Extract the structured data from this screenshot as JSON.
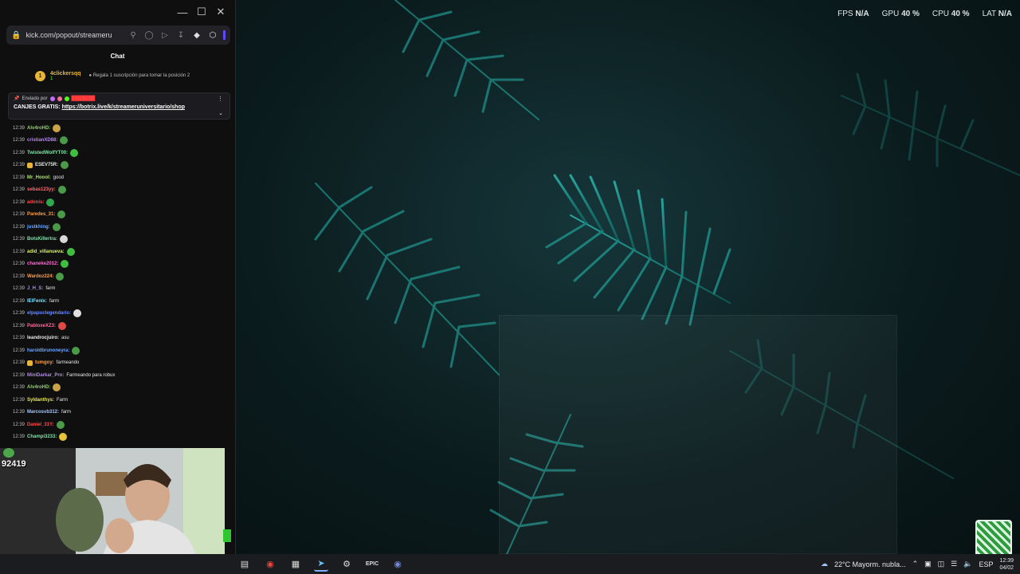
{
  "overlay": {
    "fps_label": "FPS",
    "fps_value": "N/A",
    "gpu_label": "GPU",
    "gpu_value": "40 %",
    "cpu_label": "CPU",
    "cpu_value": "40 %",
    "lat_label": "LAT",
    "lat_value": "N/A"
  },
  "browser": {
    "url": "kick.com/popout/streameru",
    "icons": [
      "search-icon",
      "shield-icon",
      "play-icon",
      "download-icon",
      "extension-icon",
      "cube-icon"
    ]
  },
  "chat": {
    "title": "Chat",
    "gifter": {
      "rank": "1",
      "name": "4clickersqq",
      "sub": "1",
      "text": "Regala 1 suscripción para tomar la posición 2"
    },
    "pinned": {
      "sent_by": "Enviado por",
      "message_prefix": "CANJES GRATIS:",
      "link": "https://botrix.live/k/streameruniversitario/shop"
    },
    "messages": [
      {
        "time": "12:39",
        "user": "Alv4roHD:",
        "text": "",
        "color": "#8fd16a",
        "badge": false,
        "emote": "#c9a24a"
      },
      {
        "time": "12:39",
        "user": "cristianXD88:",
        "text": "",
        "color": "#b08be0",
        "badge": false,
        "emote": "#4a9a4a"
      },
      {
        "time": "12:39",
        "user": "TwistedWolfYT00:",
        "text": "",
        "color": "#7fe3a8",
        "badge": false,
        "emote": "#3fbf3f"
      },
      {
        "time": "12:39",
        "user": "ESEV75R:",
        "text": "",
        "color": "#e8e8e8",
        "badge": true,
        "emote": "#4a9a4a"
      },
      {
        "time": "12:39",
        "user": "Mr_Hoool:",
        "text": "good",
        "color": "#a6e36a",
        "badge": false,
        "emote": ""
      },
      {
        "time": "12:39",
        "user": "sebas123yy:",
        "text": "",
        "color": "#ff6b6b",
        "badge": false,
        "emote": "#4a9a4a"
      },
      {
        "time": "12:39",
        "user": "adonis:",
        "text": "",
        "color": "#ff4b4b",
        "badge": false,
        "emote": "#2fa84f"
      },
      {
        "time": "12:39",
        "user": "Paredes_31:",
        "text": "",
        "color": "#ff9f4a",
        "badge": false,
        "emote": "#4a9a4a"
      },
      {
        "time": "12:39",
        "user": "justkhing:",
        "text": "",
        "color": "#6aa8ff",
        "badge": false,
        "emote": "#4a9a4a"
      },
      {
        "time": "12:39",
        "user": "BotsKillertra:",
        "text": "",
        "color": "#7fe3a8",
        "badge": false,
        "emote": "#d8d8d8"
      },
      {
        "time": "12:39",
        "user": "adid_villanueva:",
        "text": "",
        "color": "#d6f06a",
        "badge": false,
        "emote": "#3fbf3f"
      },
      {
        "time": "12:39",
        "user": "chaneke2012:",
        "text": "",
        "color": "#ff6bd1",
        "badge": false,
        "emote": "#3fbf3f"
      },
      {
        "time": "12:39",
        "user": "Wardoz224:",
        "text": "",
        "color": "#ff9f4a",
        "badge": false,
        "emote": "#4a9a4a"
      },
      {
        "time": "12:39",
        "user": "J_H_S:",
        "text": "farm",
        "color": "#b08be0",
        "badge": false,
        "emote": ""
      },
      {
        "time": "12:39",
        "user": "lElFenix:",
        "text": "farm",
        "color": "#7fe3ff",
        "badge": false,
        "emote": ""
      },
      {
        "time": "12:39",
        "user": "elpapuclegendario:",
        "text": "",
        "color": "#6a8bff",
        "badge": false,
        "emote": "#e0e0e0"
      },
      {
        "time": "12:39",
        "user": "PabloxeXZ3:",
        "text": "",
        "color": "#ff6b9f",
        "badge": false,
        "emote": "#e04848"
      },
      {
        "time": "12:39",
        "user": "leandrocjuiro:",
        "text": "asu",
        "color": "#e8e8e8",
        "badge": false,
        "emote": ""
      },
      {
        "time": "12:39",
        "user": "haroldbrunoneyra:",
        "text": "",
        "color": "#6aa8ff",
        "badge": false,
        "emote": "#4a9a4a"
      },
      {
        "time": "12:39",
        "user": "tumgoy:",
        "text": "farmeando",
        "color": "#ff9f4a",
        "badge": true,
        "emote": ""
      },
      {
        "time": "12:39",
        "user": "MiniDarkar_Pro:",
        "text": "Farmeando para robux",
        "color": "#b08be0",
        "badge": false,
        "emote": ""
      },
      {
        "time": "12:39",
        "user": "Alv4roHD:",
        "text": "",
        "color": "#8fd16a",
        "badge": false,
        "emote": "#c9a24a"
      },
      {
        "time": "12:39",
        "user": "Syldanthys:",
        "text": "Farm",
        "color": "#e6e36a",
        "badge": false,
        "emote": ""
      },
      {
        "time": "12:39",
        "user": "Marcosvb312:",
        "text": "farm",
        "color": "#a6c8ff",
        "badge": false,
        "emote": ""
      },
      {
        "time": "12:39",
        "user": "Daniel_31Y:",
        "text": "",
        "color": "#ff4b4b",
        "badge": false,
        "emote": "#4a9a4a"
      },
      {
        "time": "12:39",
        "user": "Champi3233:",
        "text": "",
        "color": "#7fe3a8",
        "badge": false,
        "emote": "#e6c23a"
      }
    ]
  },
  "webcam": {
    "sub_count": "92419"
  },
  "taskbar": {
    "apps": [
      "file-explorer-icon",
      "chrome-icon",
      "calendar-icon",
      "steam-icon",
      "settings-icon",
      "epic-games-icon",
      "discord-icon"
    ],
    "weather": "22°C  Mayorm. nubla...",
    "lang": "ESP",
    "time": "12:39",
    "date": "04/02"
  }
}
